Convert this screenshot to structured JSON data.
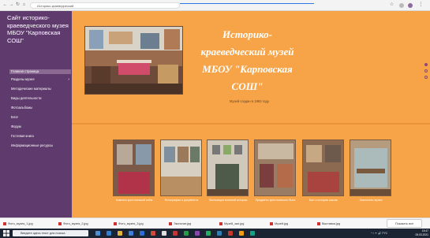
{
  "browser": {
    "url": "Историко-краеведческий",
    "nav": {
      "back": "←",
      "forward": "→",
      "reload": "↻",
      "home": "⌂"
    }
  },
  "sidebar": {
    "site_title": "Сайт историко-краеведческого музея МБОУ \"Карповская СОШ\"",
    "items": [
      {
        "label": "Главная страница",
        "active": true
      },
      {
        "label": "Разделы музея",
        "has_submenu": true
      },
      {
        "label": "Методические материалы"
      },
      {
        "label": "Виды деятельности"
      },
      {
        "label": "Фотоальбомы"
      },
      {
        "label": "Блог"
      },
      {
        "label": "Форум"
      },
      {
        "label": "Гостевая книга"
      },
      {
        "label": "Информационные ресурсы"
      }
    ]
  },
  "main": {
    "title": "Историко-краеведческий музей МБОУ \"Карповская СОШ\"",
    "subtitle": "Музей создан в 1983 году",
    "gallery": [
      {
        "caption": "Комната крестьянской избы"
      },
      {
        "caption": "Фотографии и документы"
      },
      {
        "caption": "Экспозиция военной истории"
      },
      {
        "caption": "Предметы крестьянского быта"
      },
      {
        "caption": "Быт и история школы"
      },
      {
        "caption": "Экспонаты музея"
      }
    ]
  },
  "downloads": {
    "items": [
      "Фото_музея_1.jpg",
      "Фото_музея_2.jpg",
      "Фото_музея_3.jpg",
      "Экспонат.jpg",
      "Музей_зал.jpg",
      "Музей.jpg",
      "Выставка.jpg"
    ],
    "show_all": "Показать все"
  },
  "taskbar": {
    "search_placeholder": "Введите здесь текст для поиска",
    "time": "15:47",
    "date": "05.03.2021",
    "tray": "^ ▪ ᯤ 🔊 РУС"
  }
}
